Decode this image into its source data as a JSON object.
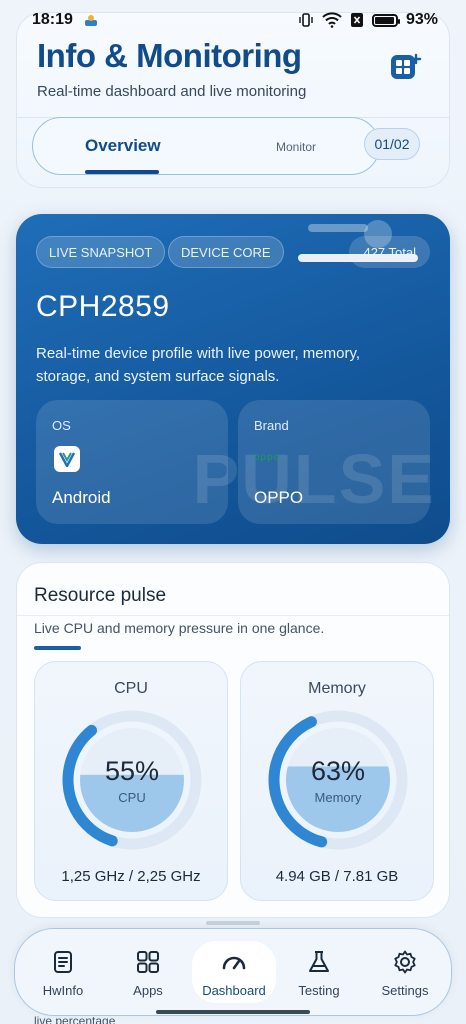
{
  "status_bar": {
    "time": "18:19",
    "battery": "93%"
  },
  "header": {
    "title": "Info & Monitoring",
    "subtitle": "Real-time dashboard and live monitoring",
    "tabs": [
      {
        "label": "Overview"
      },
      {
        "label": "Monitor"
      }
    ],
    "page_counter": "01/02"
  },
  "hero": {
    "chips": [
      "LIVE SNAPSHOT",
      "DEVICE CORE"
    ],
    "total": "427 Total",
    "model": "CPH2859",
    "description": "Real-time device profile with live power, memory, storage, and system surface signals.",
    "watermark": "PULSE",
    "tiles": [
      {
        "label": "OS",
        "value": "Android",
        "icon": "android-logo-icon"
      },
      {
        "label": "Brand",
        "value": "OPPO",
        "logo_text": "oppo"
      }
    ]
  },
  "resource": {
    "title": "Resource pulse",
    "subtitle": "Live CPU and memory pressure in one glance.",
    "gauges": [
      {
        "title": "CPU",
        "percent_label": "55%",
        "percent": 55,
        "sub": "CPU",
        "footer": "1,25 GHz / 2,25 GHz"
      },
      {
        "title": "Memory",
        "percent_label": "63%",
        "percent": 63,
        "sub": "Memory",
        "footer": "4.94 GB / 7.81 GB"
      }
    ]
  },
  "nav": {
    "items": [
      {
        "label": "HwInfo",
        "icon": "document-icon"
      },
      {
        "label": "Apps",
        "icon": "grid-icon"
      },
      {
        "label": "Dashboard",
        "icon": "gauge-icon",
        "active": true
      },
      {
        "label": "Testing",
        "icon": "flask-icon"
      },
      {
        "label": "Settings",
        "icon": "gear-icon"
      }
    ]
  },
  "peek_text": "live percentage",
  "colors": {
    "primary": "#124b89",
    "hero": "#1a62ab",
    "gauge_arc": "#2f86d3"
  }
}
